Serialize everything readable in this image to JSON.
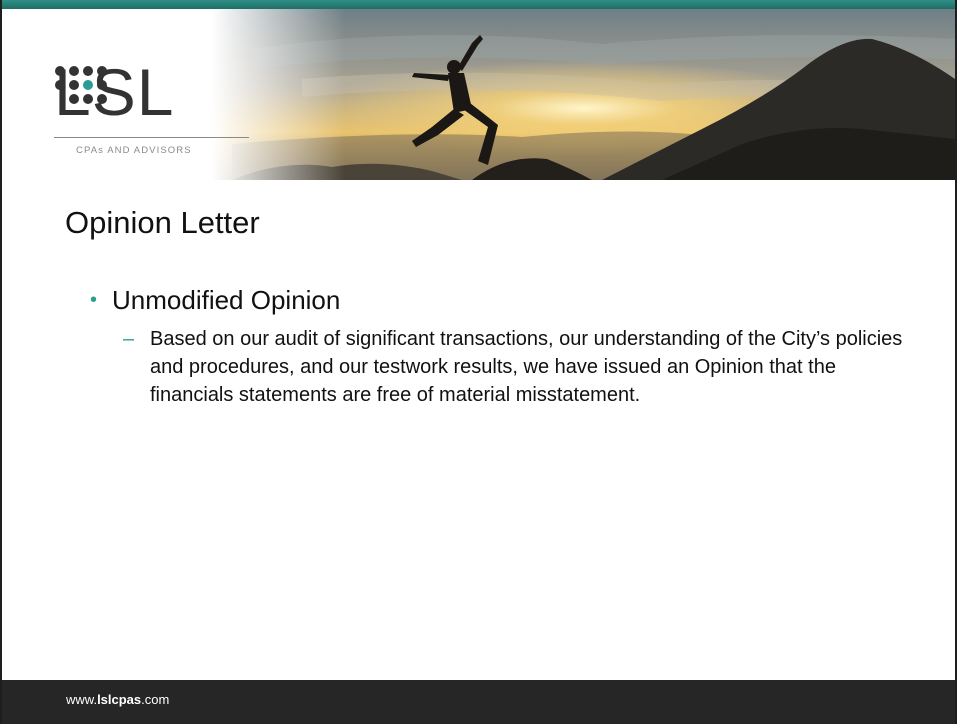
{
  "logo": {
    "letters": "LSL",
    "tagline": "CPAs AND ADVISORS"
  },
  "slide": {
    "title": "Opinion Letter",
    "bullet": "Unmodified Opinion",
    "sub_bullet": "Based on our audit of significant transactions, our understanding of the City’s policies and procedures, and our testwork results, we have issued an Opinion that the financials statements are free of material misstatement."
  },
  "footer": {
    "prefix": "www.",
    "domain": "lslcpas",
    "suffix": ".com"
  },
  "colors": {
    "accent": "#2a9d92",
    "top_bar": "#2f8f86",
    "footer_bg": "#262626"
  },
  "icons": {
    "bullet": "round-bullet",
    "sub_bullet": "en-dash"
  }
}
